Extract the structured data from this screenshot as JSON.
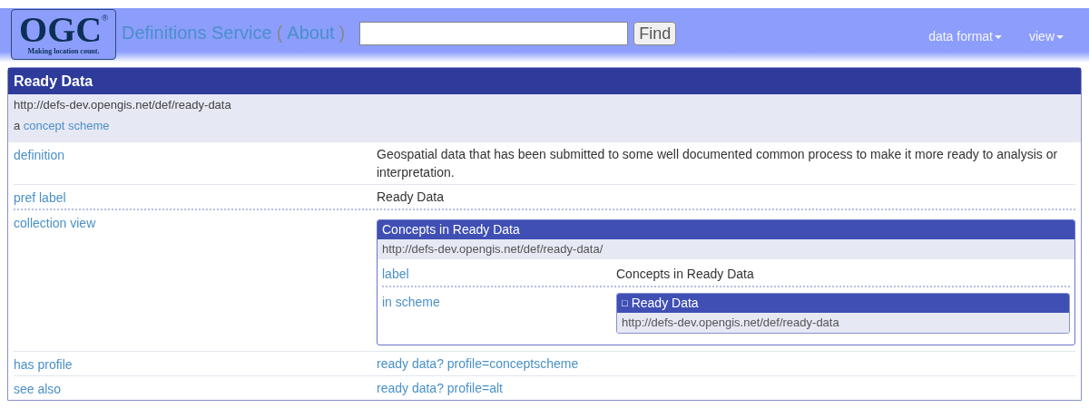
{
  "header": {
    "logo": {
      "mark": "OGC",
      "reg": "®",
      "tagline": "Making location count."
    },
    "title": "Definitions Service",
    "about_open": "(",
    "about": "About",
    "about_close": ")",
    "find_button": "Find",
    "menus": [
      {
        "label": "data format"
      },
      {
        "label": "view"
      }
    ]
  },
  "resource": {
    "title": "Ready Data",
    "uri": "http://defs-dev.opengis.net/def/ready-data",
    "type_prefix": "a",
    "type_link": "concept scheme",
    "rows": [
      {
        "label": "definition",
        "kind": "text",
        "value": "Geospatial data that has been submitted to some well documented common process to make it more ready to analysis or interpretation.",
        "dotted_rule": false
      },
      {
        "label": "pref label",
        "kind": "text",
        "value": "Ready Data",
        "dotted_rule": true
      },
      {
        "label": "collection view",
        "kind": "nested",
        "dotted_rule": false,
        "box": {
          "title": "Concepts in Ready Data",
          "uri": "http://defs-dev.opengis.net/def/ready-data/",
          "rows": [
            {
              "label": "label",
              "kind": "text",
              "value": "Concepts in Ready Data",
              "dotted_rule": true
            },
            {
              "label": "in scheme",
              "kind": "nested",
              "box": {
                "icon": "□",
                "title": "Ready Data",
                "uri": "http://defs-dev.opengis.net/def/ready-data"
              }
            }
          ]
        }
      },
      {
        "label": "has profile",
        "kind": "link",
        "value": "ready data? profile=conceptscheme",
        "dotted_rule": false
      },
      {
        "label": "see also",
        "kind": "link",
        "value": "ready data? profile=alt"
      }
    ]
  }
}
